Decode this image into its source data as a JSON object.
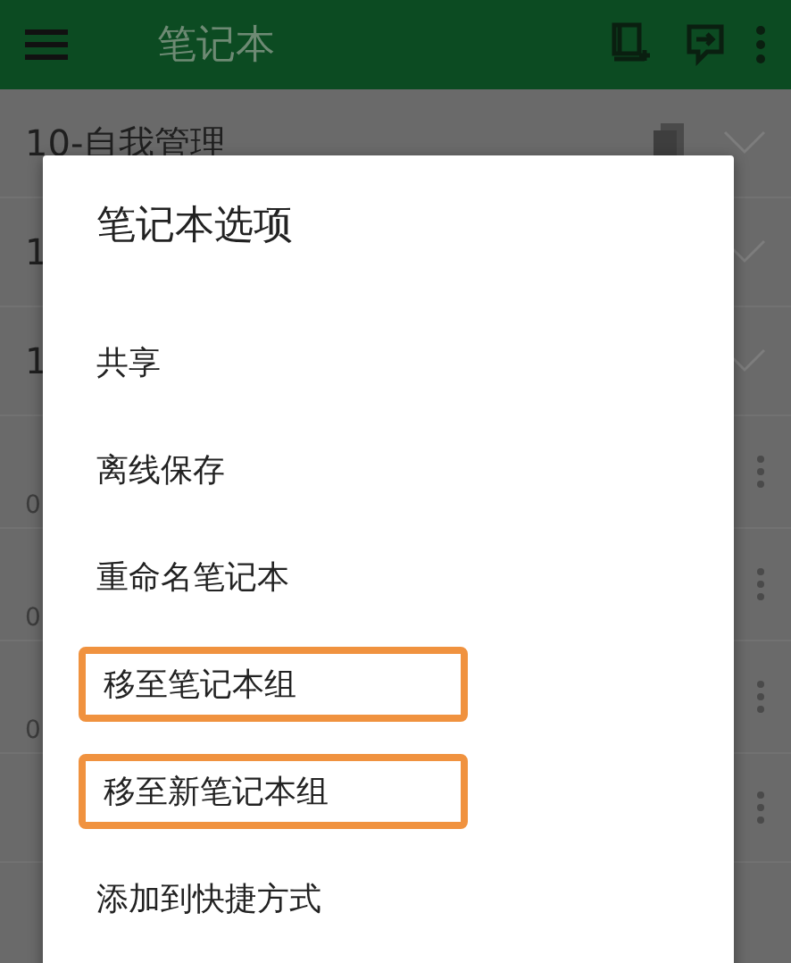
{
  "app_bar": {
    "title": "笔记本"
  },
  "notebooks": [
    {
      "name": "10-自我管理",
      "kind": "stack"
    },
    {
      "name": "1",
      "kind": "stack"
    },
    {
      "name": "1",
      "kind": "stack"
    },
    {
      "count": "0",
      "kind": "notebook"
    },
    {
      "count": "0",
      "kind": "notebook"
    },
    {
      "count": "0",
      "kind": "notebook"
    },
    {
      "kind": "notebook"
    }
  ],
  "dialog": {
    "title": "笔记本选项",
    "options": [
      {
        "label": "共享",
        "highlighted": false
      },
      {
        "label": "离线保存",
        "highlighted": false
      },
      {
        "label": "重命名笔记本",
        "highlighted": false
      },
      {
        "label": "移至笔记本组",
        "highlighted": true
      },
      {
        "label": "移至新笔记本组",
        "highlighted": true
      },
      {
        "label": "添加到快捷方式",
        "highlighted": false
      }
    ]
  }
}
